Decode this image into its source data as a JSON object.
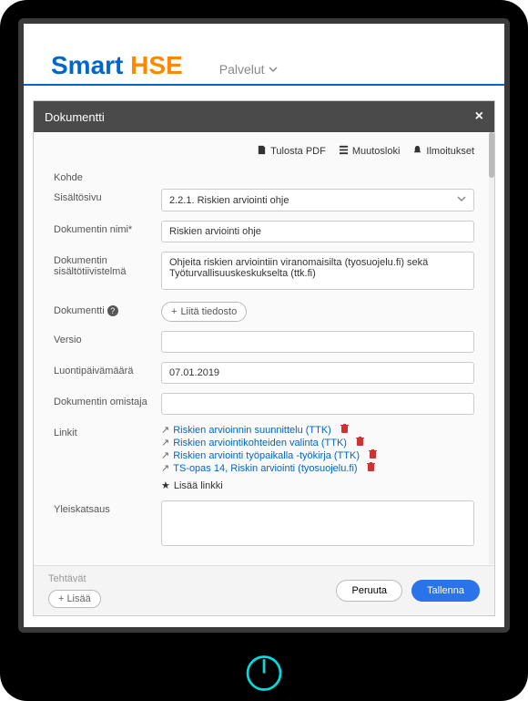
{
  "brand": {
    "part1": "Smart",
    "part2": "HSE"
  },
  "nav": {
    "label": "Palvelut"
  },
  "modal": {
    "title": "Dokumentti",
    "toolbar": {
      "print": "Tulosta PDF",
      "changelog": "Muutosloki",
      "notifications": "Ilmoitukset"
    },
    "labels": {
      "target": "Kohde",
      "contentPage": "Sisältösivu",
      "docName": "Dokumentin nimi*",
      "summary": "Dokumentin sisältötiivistelmä",
      "document": "Dokumentti",
      "version": "Versio",
      "createdDate": "Luontipäivämäärä",
      "owner": "Dokumentin omistaja",
      "links": "Linkit",
      "overview": "Yleiskatsaus"
    },
    "values": {
      "contentPage": "2.2.1. Riskien arviointi ohje",
      "docName": "Riskien arviointi ohje",
      "summary": "Ohjeita riskien arviointiin viranomaisilta (tyosuojelu.fi) sekä Työturvallisuuskeskukselta (ttk.fi)",
      "version": "",
      "createdDate": "07.01.2019",
      "owner": "",
      "overview": ""
    },
    "attach": "Liitä tiedosto",
    "addLink": "Lisää linkki",
    "links": [
      {
        "text": "Riskien arvioinnin suunnittelu (TTK)"
      },
      {
        "text": "Riskien arviointikohteiden valinta (TTK)"
      },
      {
        "text": "Riskien arviointi työpaikalla -työkirja (TTK)"
      },
      {
        "text": "TS-opas 14, Riskin arviointi (tyosuojelu.fi)"
      }
    ],
    "footer": {
      "tasks": "Tehtävät",
      "add": "Lisää",
      "cancel": "Peruuta",
      "save": "Tallenna"
    }
  }
}
